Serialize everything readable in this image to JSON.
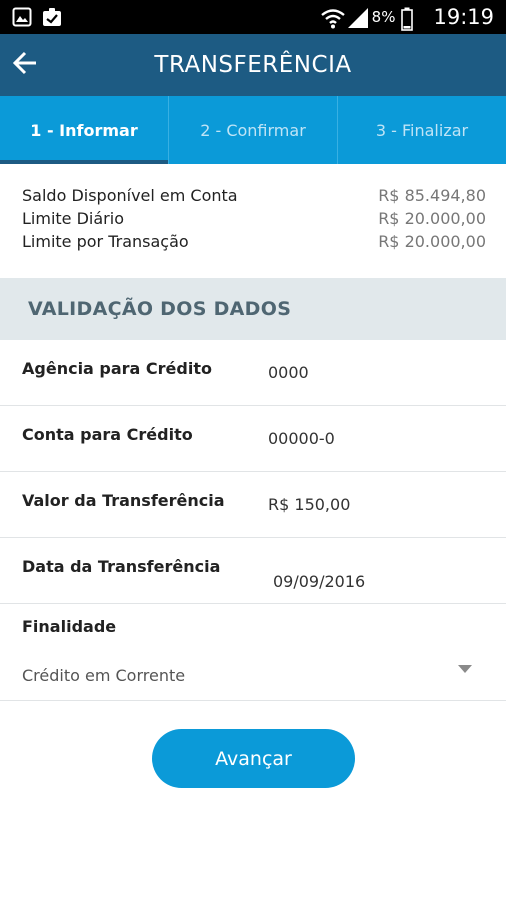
{
  "status_bar": {
    "battery_percent": "8%",
    "time": "19:19",
    "icons": [
      "gallery-icon",
      "clipboard-check-icon",
      "wifi-icon",
      "signal-icon",
      "battery-icon"
    ]
  },
  "app_bar": {
    "title": "TRANSFERÊNCIA",
    "back_icon": "arrow-left-icon"
  },
  "steps": [
    {
      "label": "1 - Informar",
      "active": true
    },
    {
      "label": "2 - Confirmar",
      "active": false
    },
    {
      "label": "3 - Finalizar",
      "active": false
    }
  ],
  "balances": [
    {
      "label": "Saldo Disponível em Conta",
      "value": "R$ 85.494,80"
    },
    {
      "label": "Limite Diário",
      "value": "R$ 20.000,00"
    },
    {
      "label": "Limite por Transação",
      "value": "R$ 20.000,00"
    }
  ],
  "section": {
    "title": "VALIDAÇÃO DOS DADOS"
  },
  "form": {
    "agencia": {
      "label": "Agência para Crédito",
      "value": "0000"
    },
    "conta": {
      "label": "Conta para Crédito",
      "value": "00000-0"
    },
    "valor": {
      "label": "Valor da Transferência",
      "value": "R$ 150,00"
    },
    "data": {
      "label": "Data da Transferência",
      "value": "09/09/2016"
    },
    "finalidade": {
      "label": "Finalidade",
      "value": "Crédito em Corrente"
    }
  },
  "actions": {
    "next_label": "Avançar"
  },
  "colors": {
    "app_bar": "#1d5b83",
    "steps_bar": "#0b9ad8",
    "section_bg": "#e1e8eb",
    "button": "#0b9ad8"
  }
}
